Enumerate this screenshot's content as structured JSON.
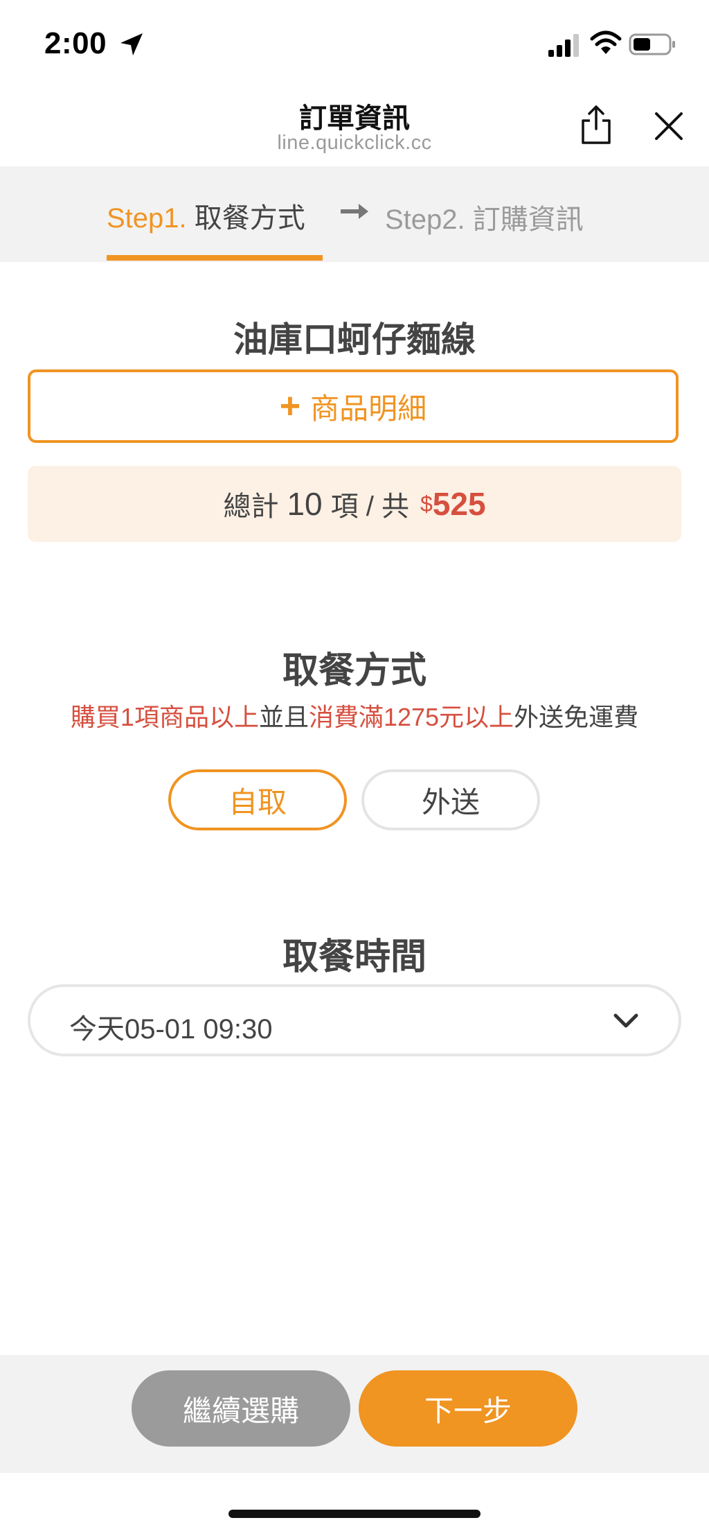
{
  "status_bar": {
    "time": "2:00",
    "battery_level": 0.5
  },
  "header": {
    "title": "訂單資訊",
    "url": "line.quickclick.cc"
  },
  "steps": {
    "step1_num": "Step1.",
    "step1_label": "取餐方式",
    "step2": "Step2. 訂購資訊"
  },
  "store": {
    "name": "油庫口蚵仔麵線",
    "detail_button": "商品明細",
    "total_prefix": "總計",
    "total_count": "10",
    "total_mid": "項 / 共",
    "currency": "$",
    "total_amount": "525"
  },
  "pickup": {
    "title": "取餐方式",
    "promo_part1": "購買1項商品以上",
    "promo_part2": "並且",
    "promo_part3": "消費滿1275元以上",
    "promo_part4": "外送免運費",
    "option_self": "自取",
    "option_delivery": "外送",
    "selected": "自取"
  },
  "pickup_time": {
    "title": "取餐時間",
    "value": "今天05-01 09:30"
  },
  "footer": {
    "continue_button": "繼續選購",
    "next_button": "下一步"
  },
  "colors": {
    "accent": "#f09422",
    "price_red": "#d64f3f",
    "total_bg": "#fdf0e4",
    "secondary_button": "#9b9b9b"
  },
  "icons": [
    "location-arrow-icon",
    "signal-icon",
    "wifi-icon",
    "battery-icon",
    "share-icon",
    "close-icon",
    "arrow-right-icon",
    "plus-icon",
    "chevron-down-icon"
  ]
}
